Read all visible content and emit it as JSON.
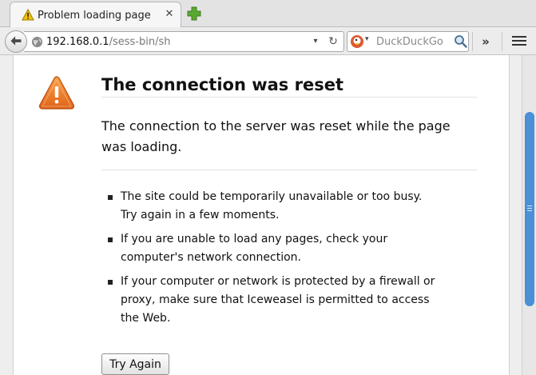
{
  "tab": {
    "title": "Problem loading page",
    "close_glyph": "✕",
    "icon": "warning-icon"
  },
  "toolbar": {
    "url_host": "192.168.0.1",
    "url_path": "/sess-bin/sh",
    "reload_glyph": "↻",
    "dropdown_glyph": "▾",
    "search_dropdown_glyph": "▾",
    "search_placeholder": "DuckDuckGo",
    "overflow_glyph": "»",
    "icons": [
      "back-icon",
      "globe-icon",
      "duckduckgo-icon",
      "search-icon",
      "menu-icon",
      "new-tab-icon"
    ]
  },
  "error": {
    "title": "The connection was reset",
    "description": "The connection to the server was reset while the page was loading.",
    "bullets": [
      [
        "The site could be temporarily unavailable or too busy.",
        "Try again in a few moments."
      ],
      [
        "If you are unable to load any pages, check your",
        "computer's network connection."
      ],
      [
        "If your computer or network is protected by a firewall or",
        "proxy, make sure that Iceweasel is permitted to access",
        "the Web."
      ]
    ],
    "button_label": "Try Again"
  },
  "colors": {
    "warning_orange": "#e8761f",
    "scroll_thumb": "#4b8fd6",
    "new_tab_green": "#5aa832"
  }
}
